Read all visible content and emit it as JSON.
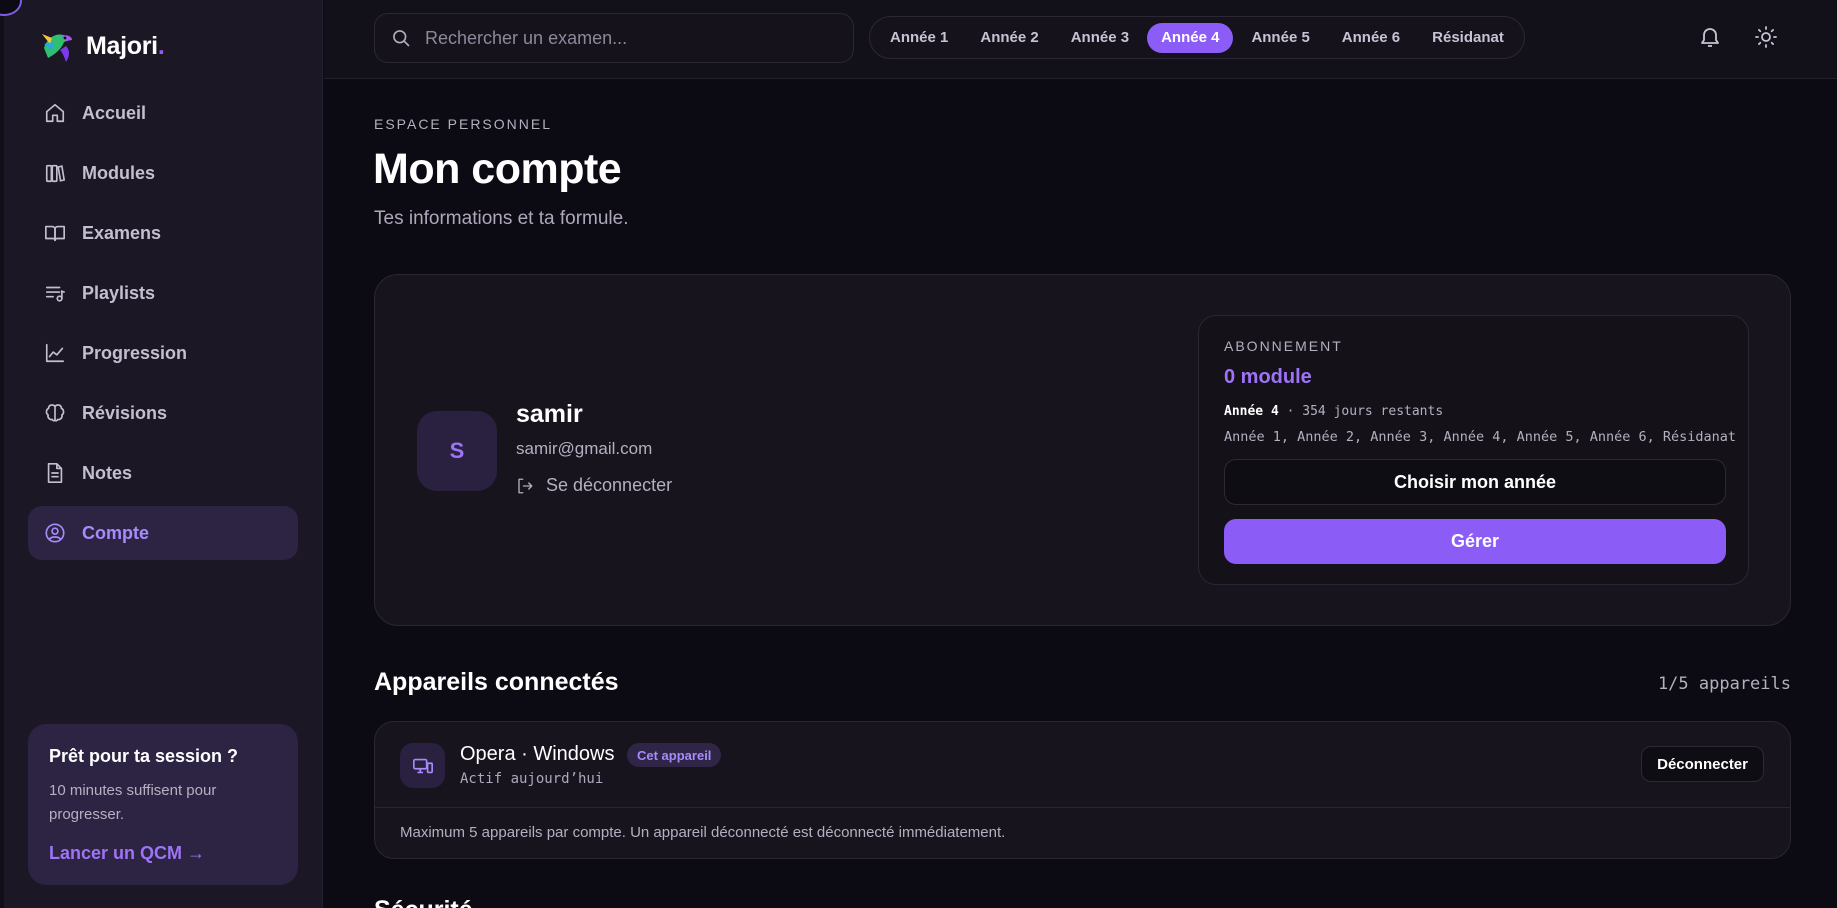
{
  "brand": {
    "name": "Majori",
    "dot": "."
  },
  "sidebar": {
    "items": [
      {
        "label": "Accueil",
        "icon": "home-icon"
      },
      {
        "label": "Modules",
        "icon": "books-icon"
      },
      {
        "label": "Examens",
        "icon": "book-open-icon"
      },
      {
        "label": "Playlists",
        "icon": "playlist-icon"
      },
      {
        "label": "Progression",
        "icon": "chart-line-icon"
      },
      {
        "label": "Révisions",
        "icon": "brain-icon"
      },
      {
        "label": "Notes",
        "icon": "note-icon"
      },
      {
        "label": "Compte",
        "icon": "user-circle-icon",
        "active": true
      }
    ],
    "promo": {
      "title": "Prêt pour ta session ?",
      "text": "10 minutes suffisent pour progresser.",
      "link": "Lancer un QCM →"
    }
  },
  "topbar": {
    "search_placeholder": "Rechercher un examen...",
    "years": [
      "Année 1",
      "Année 2",
      "Année 3",
      "Année 4",
      "Année 5",
      "Année 6",
      "Résidanat"
    ],
    "active_year": "Année 4"
  },
  "page": {
    "eyebrow": "ESPACE PERSONNEL",
    "title": "Mon compte",
    "subtitle": "Tes informations et ta formule."
  },
  "account": {
    "initial": "S",
    "name": "samir",
    "email": "samir@gmail.com",
    "logout_label": "Se déconnecter"
  },
  "subscription": {
    "eyebrow": "ABONNEMENT",
    "modules": "0 module",
    "year": "Année 4",
    "remaining": "· 354 jours restants",
    "years_list": "Année 1, Année 2, Année 3, Année 4, Année 5, Année 6, Résidanat",
    "choose_label": "Choisir mon année",
    "manage_label": "Gérer"
  },
  "devices": {
    "title": "Appareils connectés",
    "count": "1/5 appareils",
    "items": [
      {
        "name": "Opera · Windows",
        "badge": "Cet appareil",
        "status": "Actif aujourd’hui",
        "action": "Déconnecter"
      }
    ],
    "note": "Maximum 5 appareils par compte. Un appareil déconnecté est déconnecté immédiatement."
  },
  "next_section": {
    "title": "Sécurité"
  },
  "colors": {
    "accent": "#8b5cf6",
    "accent_text": "#9d74f7",
    "background": "#0c0a12",
    "card": "#17141e"
  }
}
